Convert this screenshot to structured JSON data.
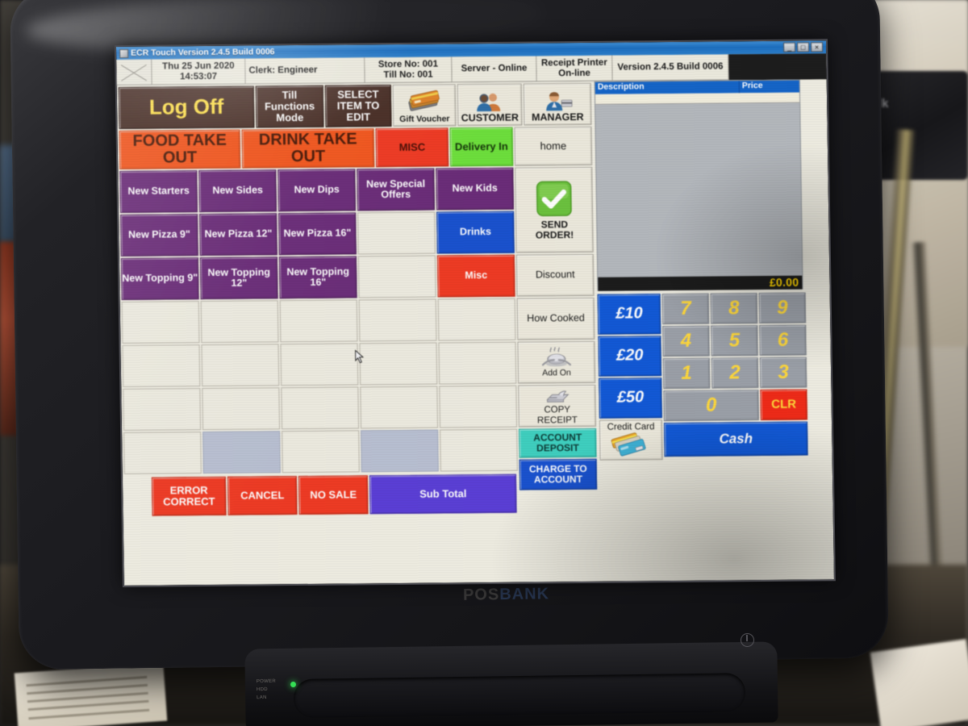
{
  "window": {
    "title": "ECR Touch Version 2.4.5 Build 0006",
    "minimize": "_",
    "maximize": "□",
    "close": "×"
  },
  "infobar": {
    "date": "Thu 25 Jun 2020",
    "time": "14:53:07",
    "clerk": "Clerk: Engineer",
    "store_no": "Store No: 001",
    "till_no": "Till No: 001",
    "server": "Server - Online",
    "printer_line1": "Receipt Printer",
    "printer_line2": "On-line",
    "version": "Version 2.4.5 Build 0006"
  },
  "function_bar": {
    "log_off": "Log Off",
    "till_functions": "Till\nFunctions\nMode",
    "select_item": "SELECT\nITEM TO\nEDIT",
    "gift_voucher": "Gift Voucher",
    "customer": "CUSTOMER",
    "manager": "MANAGER"
  },
  "categories": [
    {
      "label": "FOOD TAKE OUT",
      "color": "#f2571f"
    },
    {
      "label": "DRINK TAKE OUT",
      "color": "#f2571f"
    },
    {
      "label": "MISC",
      "color": "#ef3b24"
    },
    {
      "label": "Delivery In",
      "color": "#6ee03c"
    },
    {
      "label": "home",
      "color": "#eceade"
    }
  ],
  "products": [
    {
      "label": "New Starters",
      "color": "#6b2d79"
    },
    {
      "label": "New Sides",
      "color": "#6b2d79"
    },
    {
      "label": "New Dips",
      "color": "#6b2d79"
    },
    {
      "label": "New Special Offers",
      "color": "#6b2d79"
    },
    {
      "label": "New Kids",
      "color": "#6b2d79"
    },
    {
      "label": "New Pizza 9\"",
      "color": "#6b2d79"
    },
    {
      "label": "New Pizza 12\"",
      "color": "#6b2d79"
    },
    {
      "label": "New Pizza 16\"",
      "color": "#6b2d79"
    },
    {
      "label": "Drinks",
      "color": "#1a52cf"
    },
    {
      "label": "New Topping 9\"",
      "color": "#6b2d79"
    },
    {
      "label": "New Topping 12\"",
      "color": "#6b2d79"
    },
    {
      "label": "New Topping 16\"",
      "color": "#6b2d79"
    },
    {
      "label": "Misc",
      "color": "#ef3b24"
    }
  ],
  "side_panel": {
    "send_order": "SEND\nORDER!",
    "discount": "Discount",
    "how_cooked": "How Cooked",
    "add_on": "Add On",
    "copy_receipt": "COPY\nRECEIPT",
    "account_deposit": "ACCOUNT\nDEPOSIT",
    "charge_to_account": "CHARGE TO\nACCOUNT"
  },
  "bottom_actions": [
    {
      "label": "ERROR\nCORRECT",
      "color": "#ef3b24"
    },
    {
      "label": "CANCEL",
      "color": "#ef3b24"
    },
    {
      "label": "NO SALE",
      "color": "#ef3b24"
    },
    {
      "label": "Sub Total",
      "color": "#5b3fd6"
    }
  ],
  "receipt": {
    "col_description": "Description",
    "col_price": "Price",
    "total": "£0.00",
    "items": []
  },
  "tender": {
    "notes": [
      "£10",
      "£20",
      "£50"
    ],
    "credit_card": "Credit Card",
    "cash": "Cash"
  },
  "keypad": {
    "keys": [
      "7",
      "8",
      "9",
      "4",
      "5",
      "6",
      "1",
      "2",
      "3",
      "0"
    ],
    "clear": "CLR"
  },
  "device": {
    "brand_pos": "POS",
    "brand_bank": "BANK",
    "port_labels": "POWER\nHDD\nLAN"
  },
  "colors": {
    "titlebar": "#1d6fc0",
    "accent_orange": "#f2571f",
    "accent_purple": "#6b2d79",
    "accent_blue": "#1a52cf",
    "accent_red": "#ef3b24",
    "accent_green": "#6ee03c",
    "accent_teal": "#3fd0c0",
    "total_yellow": "#ffd400"
  }
}
